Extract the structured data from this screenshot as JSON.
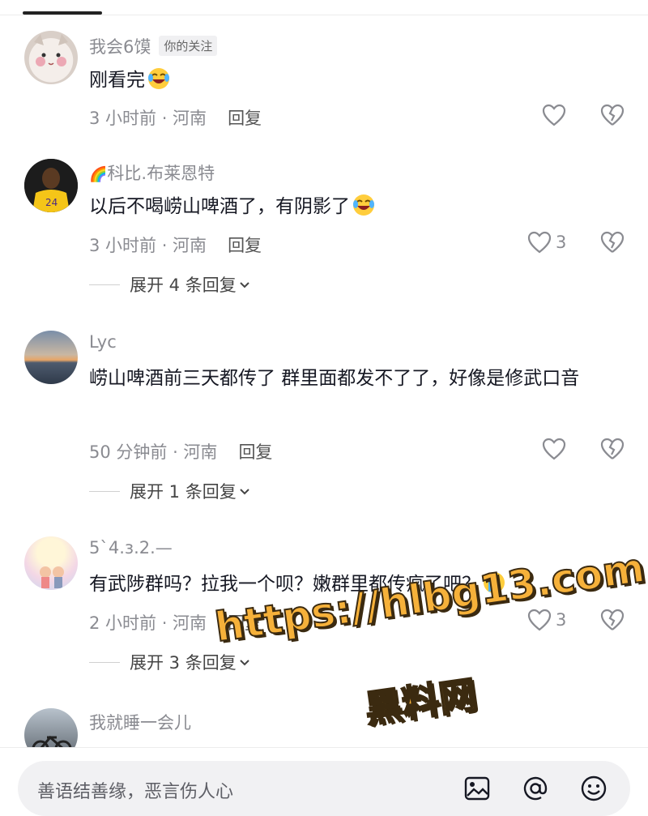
{
  "comments": [
    {
      "name": "我会6馍",
      "badge": "你的关注",
      "text": "刚看完",
      "time_loc": "3 小时前 · 河南",
      "reply": "回复",
      "likes": "",
      "avatar": "cat-avatar"
    },
    {
      "name": "科比.布莱恩特",
      "text": "以后不喝崂山啤酒了，有阴影了",
      "time_loc": "3 小时前 · 河南",
      "reply": "回复",
      "likes": "3",
      "expand": "展开 4 条回复",
      "avatar": "basketball-player-avatar"
    },
    {
      "name": "Lyc",
      "text": "崂山啤酒前三天都传了 群里面都发不了了，好像是修武口音",
      "time_loc": "50 分钟前 · 河南",
      "reply": "回复",
      "likes": "",
      "expand": "展开 1 条回复",
      "avatar": "sunset-avatar"
    },
    {
      "name": "5`4.з.2.—",
      "text": "有武陟群吗？拉我一个呗？嫩群里都传疯了吧？",
      "time_loc": "2 小时前 · 河南",
      "reply": "回复",
      "likes": "3",
      "expand": "展开 3 条回复",
      "avatar": "illustration-avatar"
    },
    {
      "name": "我就睡一会儿",
      "avatar": "motorcycle-avatar"
    }
  ],
  "input": {
    "placeholder": "善语结善缘，恶言伤人心"
  },
  "watermark": {
    "line1": "https://hlbg13.com",
    "line2": "黑料网"
  },
  "icons": [
    "heart-icon",
    "broken-heart-icon",
    "image-icon",
    "at-icon",
    "emoji-icon",
    "chevron-down-icon"
  ],
  "colors": {
    "watermark": "#f6b13a",
    "meta": "#8a8b91",
    "text": "#161823"
  }
}
